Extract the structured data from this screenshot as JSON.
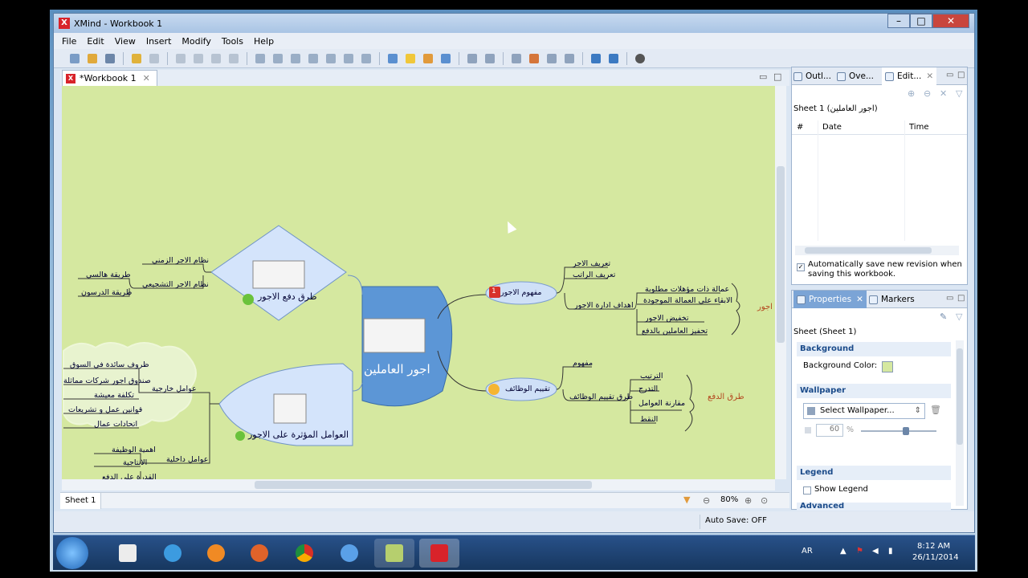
{
  "window": {
    "title": "XMind - Workbook 1",
    "minimize": "–",
    "maximize": "□",
    "close": "✕"
  },
  "menu": [
    "File",
    "Edit",
    "View",
    "Insert",
    "Modify",
    "Tools",
    "Help"
  ],
  "editor": {
    "tab_label": "*Workbook 1",
    "sheet_tab": "Sheet 1",
    "zoom": "80%"
  },
  "mindmap": {
    "central": "اجور العاملين",
    "left_top": {
      "title": "طرق دفع الاجور",
      "children": [
        "نظام الاجر الزمني",
        "نظام الاجر التشجيعي"
      ],
      "grand": [
        "طريقة هالسي",
        "طريقة الدرسون"
      ]
    },
    "left_bottom": {
      "title": "العوامل المؤثرة على الاجور",
      "external_label": "عوامل خارجية",
      "external": [
        "ظروف سائدة في السوق",
        "صندوق اجور شركات مماثلة",
        "تكلفة معيشة",
        "قوانين عمل و تشريعات",
        "اتحادات عمال"
      ],
      "internal_label": "عوامل داخلية",
      "internal": [
        "اهمية الوظيفة",
        "الانتاجية",
        "القدرة على الدفع"
      ]
    },
    "right_top": {
      "title": "مفهوم الاجور",
      "badge": "1",
      "children": [
        "تعريف الاجر",
        "تعريف الراتب",
        "اهداف ادارة الاجور"
      ],
      "goals": [
        "عمالة ذات مؤهلات مطلوبة",
        "الابقاء على العمالة الموجودة",
        "تخفيض الاجور",
        "تحفيز العاملين بالدفع"
      ],
      "summary": "اجور"
    },
    "right_bottom": {
      "title": "تقييم الوظائف",
      "children": [
        "مفهوم",
        "طرق تقييم الوظائف"
      ],
      "methods": [
        "الترتيب",
        "التدرج",
        "مقارنة العوامل",
        "النقط"
      ],
      "summary": "طرق الدفع"
    }
  },
  "outline_panel": {
    "tabs": [
      "Outl...",
      "Ove...",
      "Edit..."
    ],
    "sheet_label": "Sheet 1 (اجور العاملين)",
    "columns": [
      "#",
      "Date",
      "Time"
    ],
    "auto_save_text": "Automatically save new revision when saving this workbook."
  },
  "properties_panel": {
    "tabs": [
      "Properties",
      "Markers"
    ],
    "sheet_label": "Sheet (Sheet 1)",
    "background_section": "Background",
    "background_color_label": "Background Color:",
    "background_color": "#d5e8a0",
    "wallpaper_section": "Wallpaper",
    "wallpaper_select": "Select Wallpaper...",
    "opacity_value": "60",
    "opacity_unit": "%",
    "legend_section": "Legend",
    "show_legend": "Show Legend",
    "advanced_section": "Advanced"
  },
  "status": {
    "auto_save": "Auto Save: OFF"
  },
  "taskbar": {
    "lang": "AR",
    "time": "8:12 AM",
    "date": "26/11/2014"
  }
}
